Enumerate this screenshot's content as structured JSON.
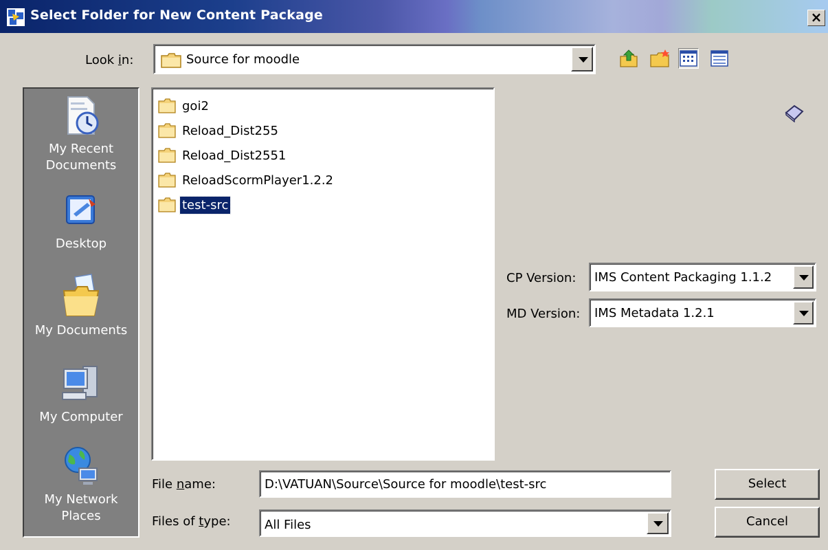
{
  "window": {
    "title": "Select Folder for New Content Package",
    "close_label": "×"
  },
  "look_in": {
    "label_pre": "Look ",
    "label_key": "i",
    "label_post": "n:",
    "value": "Source for moodle"
  },
  "toolbar": {
    "icons": [
      "up-one-level-icon",
      "create-new-folder-icon",
      "list-view-icon",
      "details-view-icon"
    ]
  },
  "places": [
    {
      "label": "My Recent Documents",
      "icon": "recent-documents-icon"
    },
    {
      "label": "Desktop",
      "icon": "desktop-icon"
    },
    {
      "label": "My Documents",
      "icon": "my-documents-icon"
    },
    {
      "label": "My Computer",
      "icon": "my-computer-icon"
    },
    {
      "label": "My Network Places",
      "icon": "network-places-icon"
    }
  ],
  "files": [
    {
      "name": "goi2",
      "selected": false
    },
    {
      "name": "Reload_Dist255",
      "selected": false
    },
    {
      "name": "Reload_Dist2551",
      "selected": false
    },
    {
      "name": "ReloadScormPlayer1.2.2",
      "selected": false
    },
    {
      "name": "test-src",
      "selected": true
    }
  ],
  "cp_version": {
    "label": "CP Version:",
    "value": "IMS Content Packaging 1.1.2"
  },
  "md_version": {
    "label": "MD Version:",
    "value": "IMS Metadata 1.2.1"
  },
  "file_name": {
    "label_pre": "File ",
    "label_key": "n",
    "label_post": "ame:",
    "value": "D:\\VATUAN\\Source\\Source for moodle\\test-src"
  },
  "files_of_type": {
    "label_pre": "Files of ",
    "label_key": "t",
    "label_post": "ype:",
    "value": "All Files"
  },
  "buttons": {
    "select": "Select",
    "cancel": "Cancel"
  },
  "colors": {
    "selection": "#0a246a",
    "dialog_face": "#d4d0c8",
    "places_bar": "#808080"
  }
}
